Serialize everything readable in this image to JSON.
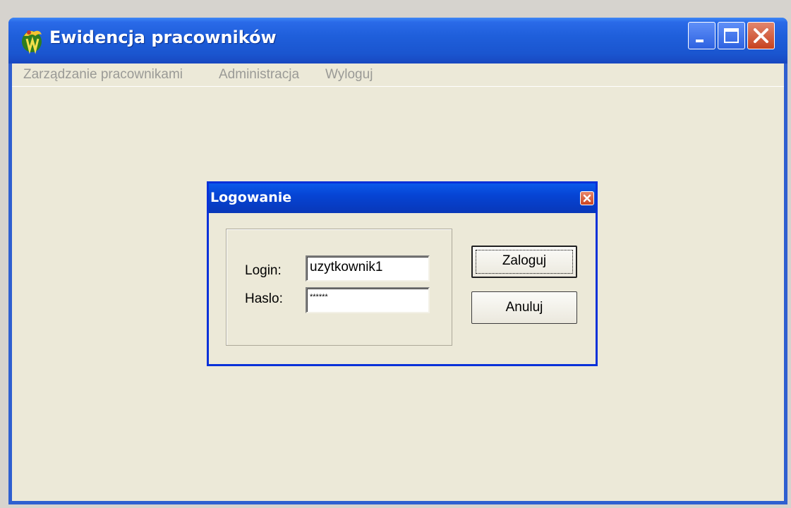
{
  "window": {
    "title": "Ewidencja pracowników",
    "accent_color": "#2f5fd0",
    "icons": {
      "app": "app-logo-icon",
      "minimize": "minimize-icon",
      "maximize": "maximize-icon",
      "close": "close-icon"
    }
  },
  "menu": {
    "items": [
      {
        "label": "Zarządzanie pracownikami"
      },
      {
        "label": "Administracja"
      },
      {
        "label": "Wyloguj"
      }
    ]
  },
  "dialog": {
    "title": "Logowanie",
    "close_icon": "close-icon",
    "login_label": "Login:",
    "login_value": "uzytkownik1",
    "password_label": "Haslo:",
    "password_value": "******",
    "submit_label": "Zaloguj",
    "cancel_label": "Anuluj"
  }
}
